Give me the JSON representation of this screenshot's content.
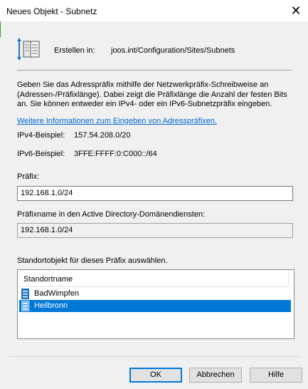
{
  "window": {
    "title": "Neues Objekt - Subnetz"
  },
  "header": {
    "create_label": "Erstellen in:",
    "create_path": "joos.int/Configuration/Sites/Subnets"
  },
  "description": {
    "text": "Geben Sie das Adresspräfix mithilfe der Netzwerkpräfix-Schreibweise an (Adressen-/Präfixlänge). Dabei zeigt die Präfixlänge die Anzahl der festen Bits an. Sie können entweder ein IPv4- oder ein IPv6-Subnetzpräfix eingeben.",
    "link": "Weitere Informationen zum Eingeben von Adresspräfixen."
  },
  "examples": {
    "ipv4_label": "IPv4-Beispiel:",
    "ipv4_value": "157.54.208.0/20",
    "ipv6_label": "IPv6-Beispiel:",
    "ipv6_value": "3FFE:FFFF:0:C000::/64"
  },
  "prefix": {
    "label": "Präfix:",
    "value": "192.168.1.0/24"
  },
  "prefix_name": {
    "label": "Präfixname in den Active Directory-Domänendiensten:",
    "value": "192.168.1.0/24"
  },
  "site_picker": {
    "label": "Standortobjekt für dieses Präfix auswählen.",
    "column_header": "Standortname",
    "items": [
      {
        "name": "BadWimpfen",
        "selected": false
      },
      {
        "name": "Heilbronn",
        "selected": true
      }
    ]
  },
  "buttons": {
    "ok": "OK",
    "cancel": "Abbrechen",
    "help": "Hilfe"
  },
  "colors": {
    "selection": "#0078d7",
    "link": "#0066cc"
  },
  "icons": {
    "close": "close-icon",
    "header": "subnet-book-icon",
    "site": "site-icon"
  }
}
